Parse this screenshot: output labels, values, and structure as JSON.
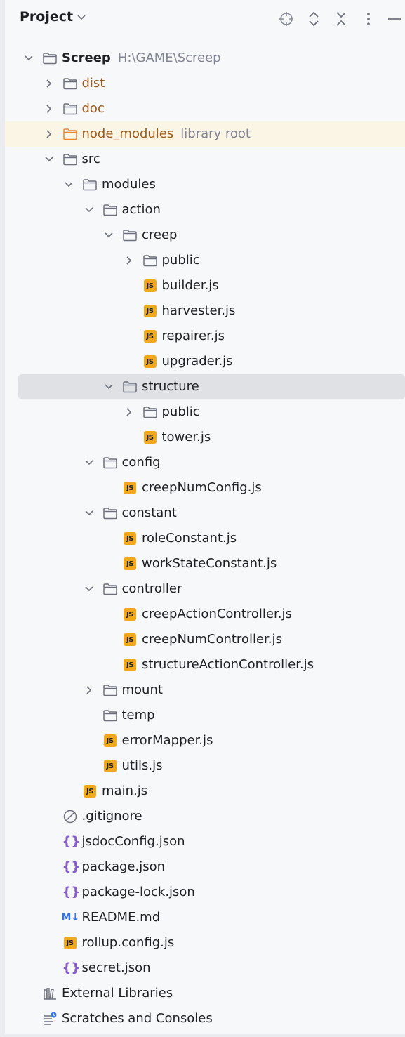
{
  "header": {
    "title": "Project",
    "title_icon": "chevron-down-icon",
    "actions": [
      "locate-icon",
      "expand-collapse-icon",
      "collapse-all-icon",
      "more-icon",
      "minimize-icon"
    ]
  },
  "colors": {
    "panel_bg": "#f7f8fa",
    "selected_row": "#dfe1e5",
    "library_root_row": "#fbf5e6",
    "excluded_folder_text": "#9e5b1b",
    "js_badge": "#f2a81c",
    "json_braces": "#8a5cd0",
    "markdown": "#3574f0",
    "hint_text": "#818594"
  },
  "tree": {
    "project_root": {
      "label": "Screep",
      "path": "H:\\GAME\\Screep"
    },
    "dist": "dist",
    "doc": "doc",
    "node_modules": {
      "label": "node_modules",
      "hint": "library root"
    },
    "src": "src",
    "modules": "modules",
    "action": "action",
    "creep": "creep",
    "creep_public": "public",
    "builder": "builder.js",
    "harvester": "harvester.js",
    "repairer": "repairer.js",
    "upgrader": "upgrader.js",
    "structure": "structure",
    "structure_public": "public",
    "tower": "tower.js",
    "config": "config",
    "creepNumConfig": "creepNumConfig.js",
    "constant": "constant",
    "roleConstant": "roleConstant.js",
    "workStateConstant": "workStateConstant.js",
    "controller": "controller",
    "creepActionController": "creepActionController.js",
    "creepNumController": "creepNumController.js",
    "structureActionController": "structureActionController.js",
    "mount": "mount",
    "temp": "temp",
    "errorMapper": "errorMapper.js",
    "utils": "utils.js",
    "main": "main.js",
    "gitignore": ".gitignore",
    "jsdocConfig": "jsdocConfig.json",
    "package": "package.json",
    "package_lock": "package-lock.json",
    "readme": "README.md",
    "rollup": "rollup.config.js",
    "secret": "secret.json",
    "external_libraries": "External Libraries",
    "scratches": "Scratches and Consoles"
  },
  "badges": {
    "js": "JS",
    "md": "M↓",
    "json": "{}"
  }
}
